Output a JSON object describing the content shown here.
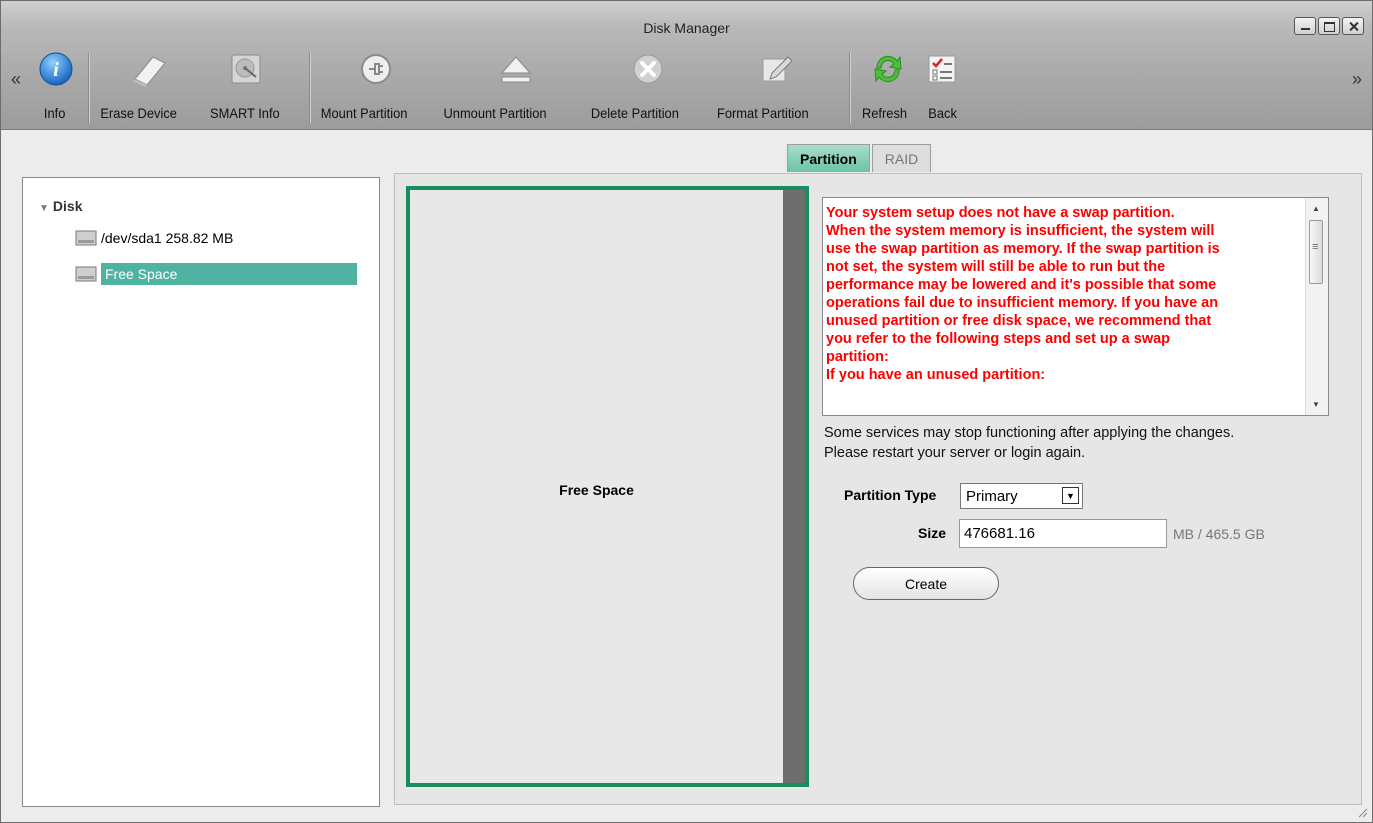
{
  "window": {
    "title": "Disk Manager"
  },
  "toolbar": {
    "items": [
      {
        "label": "Info",
        "icon": "info-icon"
      },
      {
        "label": "Erase Device",
        "icon": "eraser-icon"
      },
      {
        "label": "SMART Info",
        "icon": "hard-drive-icon"
      },
      {
        "label": "Mount Partition",
        "icon": "mount-icon"
      },
      {
        "label": "Unmount Partition",
        "icon": "eject-icon"
      },
      {
        "label": "Delete Partition",
        "icon": "delete-icon"
      },
      {
        "label": "Format Partition",
        "icon": "pencil-icon"
      },
      {
        "label": "Refresh",
        "icon": "refresh-icon"
      },
      {
        "label": "Back",
        "icon": "checklist-icon"
      }
    ],
    "scroll_left": "«",
    "scroll_right": "»"
  },
  "tree": {
    "root": "Disk",
    "items": [
      {
        "label": "/dev/sda1 258.82 MB",
        "selected": false
      },
      {
        "label": "Free Space",
        "selected": true
      }
    ]
  },
  "tabs": [
    {
      "label": "Partition",
      "active": true
    },
    {
      "label": "RAID",
      "active": false
    }
  ],
  "partition_map": {
    "label": "Free Space"
  },
  "warning": {
    "lines": [
      "Your system setup does not have a swap partition.",
      "When the system memory is insufficient, the system will",
      "use the swap partition as memory. If the swap partition is",
      "not set, the system will still be able to run but the",
      "performance may be lowered and it's possible that some",
      "operations fail due to insufficient memory. If you have an",
      "unused partition or free disk space, we recommend that",
      "you refer to the following steps and set up a swap",
      "partition:",
      "If you have an unused partition:"
    ],
    "color": "#ff0000"
  },
  "note": {
    "line1": "Some services may stop functioning after applying the changes.",
    "line2": "Please restart your server or login again."
  },
  "form": {
    "partition_type_label": "Partition Type",
    "partition_type_value": "Primary",
    "size_label": "Size",
    "size_value": "476681.16",
    "size_unit": "MB / 465.5 GB",
    "create_label": "Create"
  }
}
